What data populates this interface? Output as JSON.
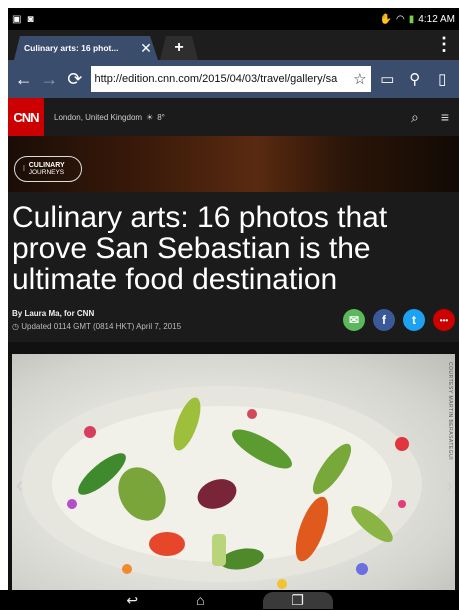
{
  "status_bar": {
    "time": "4:12 AM",
    "left_icons": [
      "image-icon",
      "photo-icon"
    ],
    "right_icons": [
      "wrench-icon",
      "wifi-icon",
      "battery-icon"
    ]
  },
  "tabs": {
    "active_title": "Culinary arts: 16 phot...",
    "close_glyph": "✕",
    "new_tab_glyph": "+",
    "menu_glyph": "⋮"
  },
  "toolbar": {
    "back_glyph": "←",
    "forward_glyph": "→",
    "reload_glyph": "⟳",
    "url": "http://edition.cnn.com/2015/04/03/travel/gallery/sa",
    "star_glyph": "☆",
    "reader_glyph": "📖",
    "search_glyph": "🔍",
    "bookmark_glyph": "🔖"
  },
  "cnn": {
    "logo": "CNN",
    "location": "London, United Kingdom",
    "weather_glyph": "☀",
    "temperature": "8°",
    "search_glyph": "⌕",
    "menu_glyph": "≡",
    "brand_color": "#cc0000"
  },
  "badge": {
    "line1": "CULINARY",
    "line2": "JOURNEYS"
  },
  "article": {
    "headline": "Culinary arts: 16 photos that prove San Sebastian is the ultimate food destination",
    "byline": "By Laura Ma, for CNN",
    "updated": "Updated 0114 GMT (0814 HKT) April 7, 2015",
    "share": [
      {
        "name": "email",
        "glyph": "✉",
        "color": "#5cb85c"
      },
      {
        "name": "facebook",
        "glyph": "f",
        "color": "#3b5998"
      },
      {
        "name": "twitter",
        "glyph": "t",
        "color": "#1da1f2"
      },
      {
        "name": "more",
        "glyph": "•••",
        "color": "#cc0000"
      }
    ]
  },
  "gallery": {
    "credit": "COURTESY MARTIN BERASATEGUI",
    "prev_glyph": "‹",
    "next_glyph": "›"
  },
  "android_nav": {
    "back_glyph": "↩",
    "home_glyph": "⌂",
    "recents_glyph": "❐"
  }
}
